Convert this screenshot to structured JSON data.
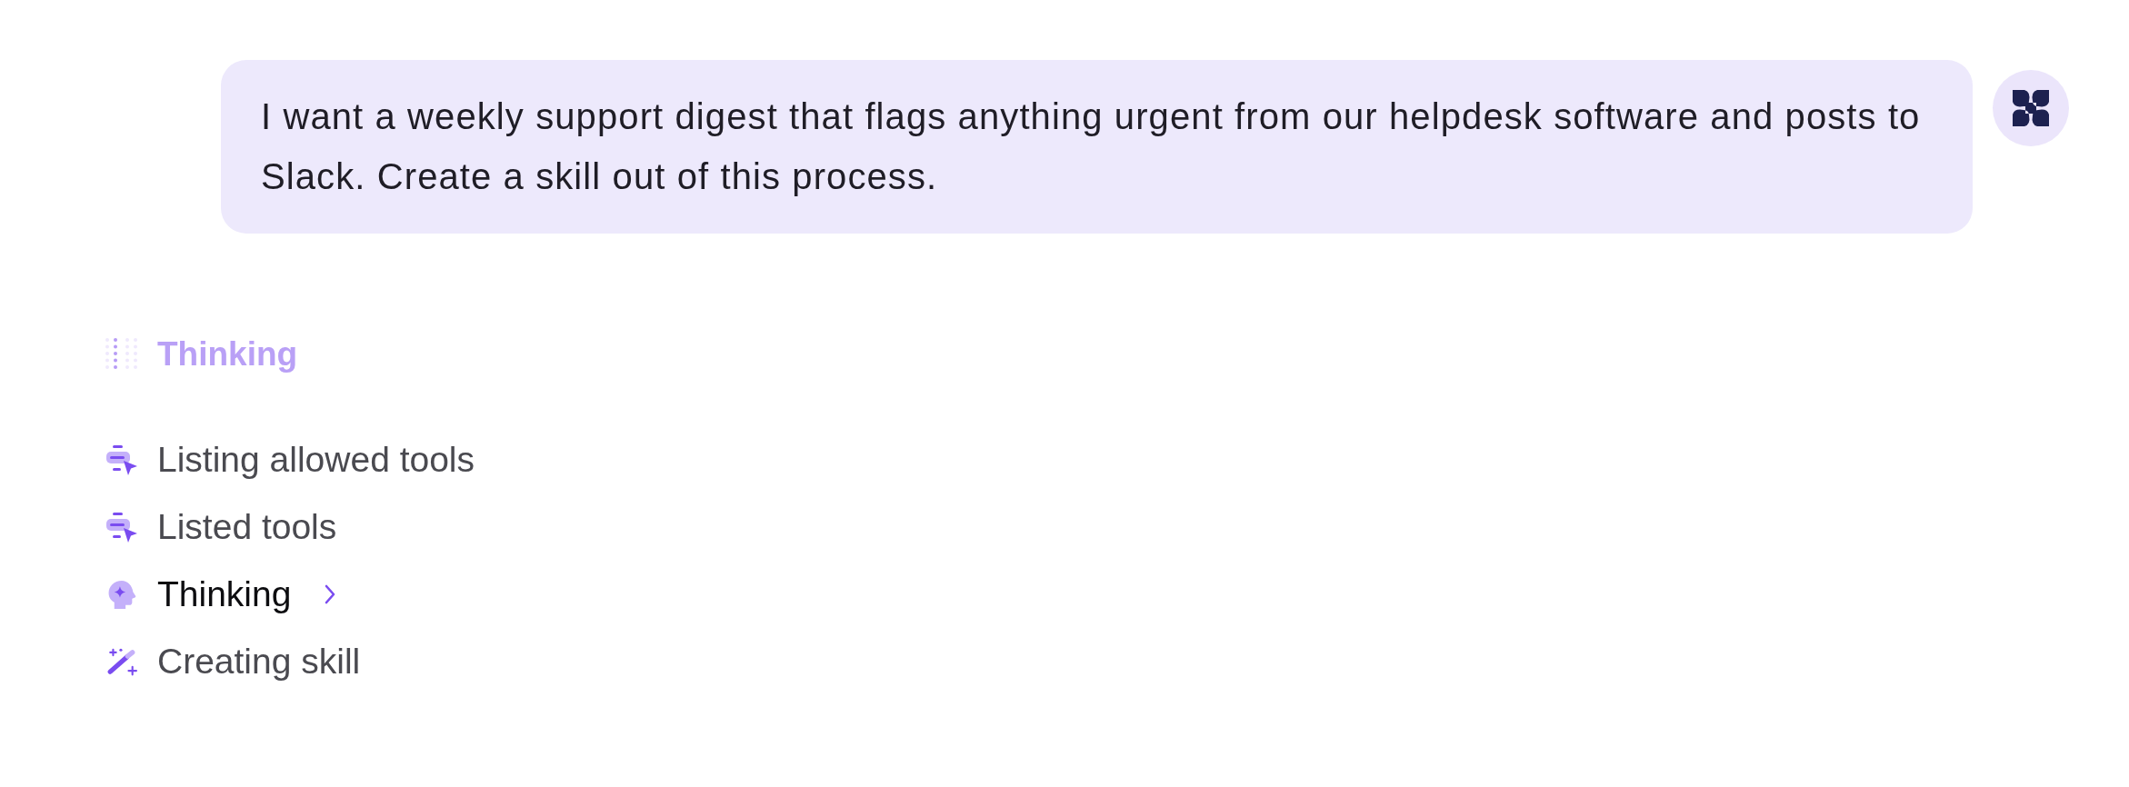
{
  "message": {
    "text": "I want a weekly support digest that flags anything urgent from our helpdesk software and posts to Slack. Create a skill out of this process."
  },
  "status": {
    "label": "Thinking"
  },
  "steps": [
    {
      "kind": "tool",
      "label": "Listing allowed tools",
      "active": false
    },
    {
      "kind": "tool",
      "label": "Listed tools",
      "active": false
    },
    {
      "kind": "thinking",
      "label": "Thinking",
      "active": true
    },
    {
      "kind": "skill",
      "label": "Creating skill",
      "active": false
    }
  ]
}
